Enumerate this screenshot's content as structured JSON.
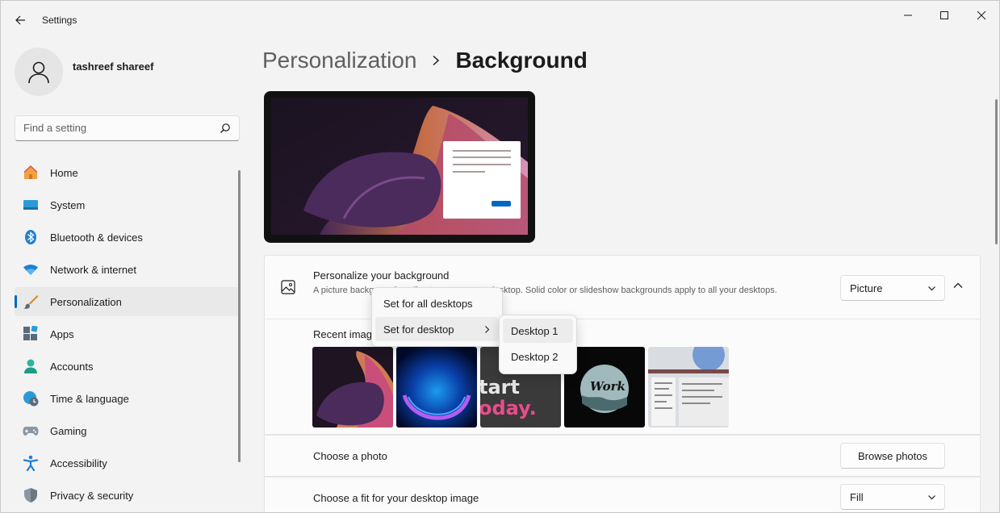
{
  "app": {
    "title": "Settings"
  },
  "user": {
    "name": "tashreef shareef"
  },
  "search": {
    "placeholder": "Find a setting"
  },
  "nav": {
    "items": [
      {
        "label": "Home",
        "icon": "home-icon"
      },
      {
        "label": "System",
        "icon": "system-icon"
      },
      {
        "label": "Bluetooth & devices",
        "icon": "bluetooth-icon"
      },
      {
        "label": "Network & internet",
        "icon": "wifi-icon"
      },
      {
        "label": "Personalization",
        "icon": "brush-icon",
        "selected": true
      },
      {
        "label": "Apps",
        "icon": "apps-icon"
      },
      {
        "label": "Accounts",
        "icon": "accounts-icon"
      },
      {
        "label": "Time & language",
        "icon": "time-language-icon"
      },
      {
        "label": "Gaming",
        "icon": "gamepad-icon"
      },
      {
        "label": "Accessibility",
        "icon": "accessibility-icon"
      },
      {
        "label": "Privacy & security",
        "icon": "shield-icon"
      }
    ]
  },
  "breadcrumb": {
    "parent": "Personalization",
    "current": "Background"
  },
  "background": {
    "title": "Personalize your background",
    "description": "A picture background applies to your current desktop. Solid color or slideshow backgrounds apply to all your desktops.",
    "type_value": "Picture",
    "recent_label": "Recent images",
    "choose_photo_label": "Choose a photo",
    "browse_label": "Browse photos",
    "fit_label": "Choose a fit for your desktop image",
    "fit_value": "Fill"
  },
  "thumbs": {
    "t3": {
      "line1": "tart",
      "line2": "oday."
    },
    "t4": {
      "word": "Work"
    }
  },
  "context_menu": {
    "items": [
      {
        "label": "Set for all desktops"
      },
      {
        "label": "Set for desktop"
      }
    ]
  },
  "submenu": {
    "items": [
      {
        "label": "Desktop 1"
      },
      {
        "label": "Desktop 2"
      }
    ]
  },
  "colors": {
    "accent": "#0067c0",
    "window_bg": "#f3f3f3",
    "card_bg": "#fbfbfb"
  }
}
